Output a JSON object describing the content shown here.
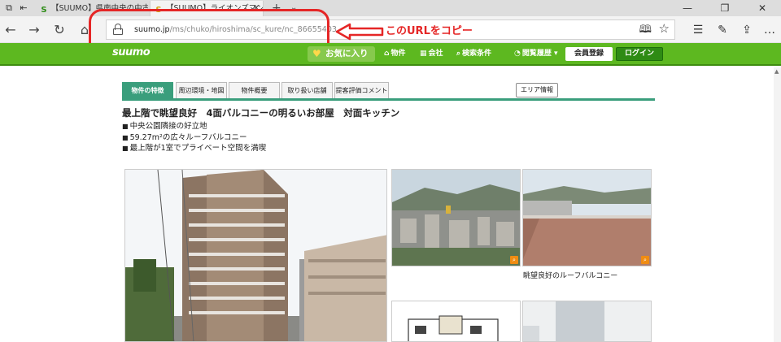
{
  "browser": {
    "tabs": [
      {
        "title": "【SUUMO】県南中央の中古マ",
        "favicon": "S"
      },
      {
        "title": "【SUUMO】ライオンズマンシ",
        "favicon": "S"
      }
    ],
    "new_tab": "+",
    "tab_menu": "⌄",
    "address": {
      "host": "suumo.jp",
      "path": "/ms/chuko/hiroshima/sc_kure/nc_86655403"
    },
    "annotation": "このURLをコピー",
    "accent_red": "#e52626"
  },
  "site": {
    "logo": "suumo",
    "favorites": "お気に入り",
    "nav": [
      {
        "label": "物件",
        "icon": "house-icon"
      },
      {
        "label": "会社",
        "icon": "building-icon"
      },
      {
        "label": "検索条件",
        "icon": "search-icon"
      },
      {
        "label": "閲覧履歴",
        "icon": "clock-icon"
      }
    ],
    "register": "会員登録",
    "login": "ログイン",
    "brand_green": "#5db820"
  },
  "page": {
    "tabs": [
      {
        "label": "物件の特徴",
        "active": true
      },
      {
        "label": "周辺環境・地図",
        "active": false
      },
      {
        "label": "物件概要",
        "active": false
      },
      {
        "label": "取り扱い店舗",
        "active": false
      },
      {
        "label": "提客評価コメント",
        "active": false
      }
    ],
    "area_button": "エリア情報",
    "headline": "最上階で眺望良好　4面バルコニーの明るいお部屋　対面キッチン",
    "bullets": [
      "中央公園隣接の好立地",
      "59.27m²の広々ルーフバルコニー",
      "最上階が1室でプライベート空間を満喫"
    ],
    "caption": "眺望良好のルーフバルコニー",
    "tab_green": "#3a9e7c"
  }
}
